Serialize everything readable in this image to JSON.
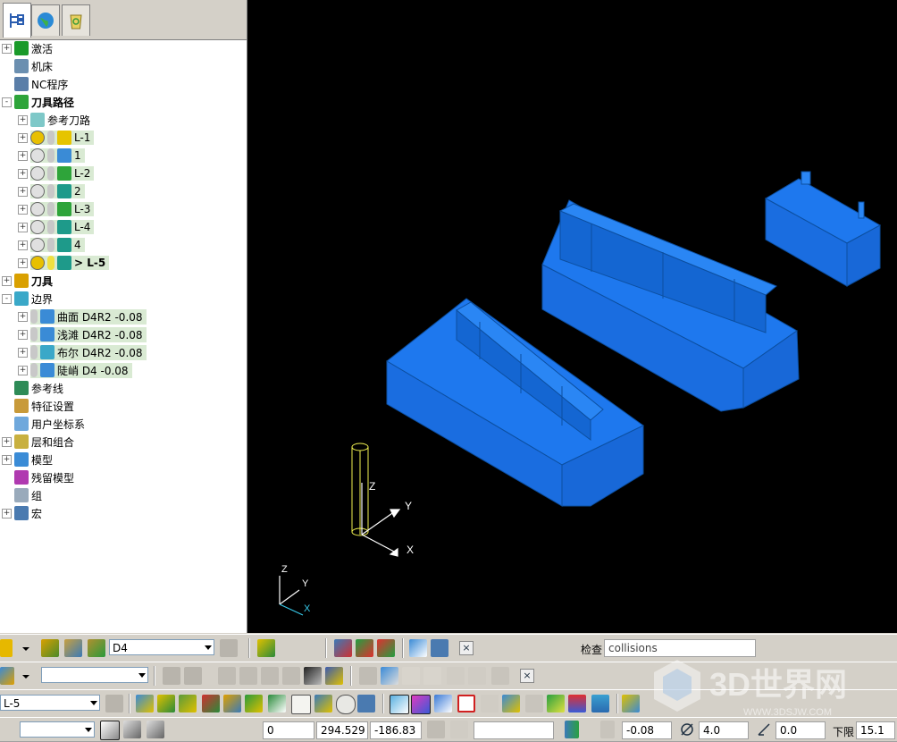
{
  "tree": {
    "items": [
      {
        "label": "激活",
        "icon": "activate-icon",
        "color": "#1a9a2a",
        "level": 0,
        "exp": "+"
      },
      {
        "label": "机床",
        "icon": "machine-icon",
        "color": "#6b8fb0",
        "level": 0,
        "exp": ""
      },
      {
        "label": "NC程序",
        "icon": "nc-program-icon",
        "color": "#5a7ea8",
        "level": 0,
        "exp": ""
      },
      {
        "label": "刀具路径",
        "icon": "toolpath-icon",
        "color": "#2ea43a",
        "level": 0,
        "exp": "-",
        "bold": true
      },
      {
        "label": "参考刀路",
        "icon": "folder-icon",
        "color": "#7ec8c8",
        "level": 1,
        "exp": "+"
      },
      {
        "label": "L-1",
        "icon": "toolpath-item-icon",
        "color": "#e6c400",
        "level": 1,
        "exp": "+",
        "hl": true
      },
      {
        "label": "1",
        "icon": "toolpath-item-icon",
        "color": "#3a8bd6",
        "level": 1,
        "exp": "+",
        "hl": true
      },
      {
        "label": "L-2",
        "icon": "toolpath-item-icon",
        "color": "#2ea43a",
        "level": 1,
        "exp": "+",
        "hl": true
      },
      {
        "label": "2",
        "icon": "toolpath-item-icon",
        "color": "#1e9a8a",
        "level": 1,
        "exp": "+",
        "hl": true
      },
      {
        "label": "L-3",
        "icon": "toolpath-item-icon",
        "color": "#2ea43a",
        "level": 1,
        "exp": "+",
        "hl": true
      },
      {
        "label": "L-4",
        "icon": "toolpath-item-icon",
        "color": "#1e9a8a",
        "level": 1,
        "exp": "+",
        "hl": true
      },
      {
        "label": "4",
        "icon": "toolpath-item-icon",
        "color": "#1e9a8a",
        "level": 1,
        "exp": "+",
        "hl": true
      },
      {
        "label": "> L-5",
        "icon": "toolpath-item-icon",
        "color": "#1e9a8a",
        "level": 1,
        "exp": "+",
        "hl": true,
        "bold": true
      },
      {
        "label": "刀具",
        "icon": "tool-icon",
        "color": "#d9a000",
        "level": 0,
        "exp": "+",
        "bold": true
      },
      {
        "label": "边界",
        "icon": "boundary-icon",
        "color": "#3aa8c8",
        "level": 0,
        "exp": "-"
      },
      {
        "label": "曲面 D4R2 -0.08",
        "icon": "boundary-item-icon",
        "color": "#3a8bd6",
        "level": 1,
        "exp": "+",
        "hl": true
      },
      {
        "label": "浅滩 D4R2 -0.08",
        "icon": "boundary-item-icon",
        "color": "#3a8bd6",
        "level": 1,
        "exp": "+",
        "hl": true
      },
      {
        "label": "布尔 D4R2 -0.08",
        "icon": "boundary-item-icon",
        "color": "#3aa8c8",
        "level": 1,
        "exp": "+",
        "hl": true
      },
      {
        "label": "陡峭 D4 -0.08",
        "icon": "boundary-item-icon",
        "color": "#3a8bd6",
        "level": 1,
        "exp": "+",
        "hl": true
      },
      {
        "label": "参考线",
        "icon": "pattern-icon",
        "color": "#2e8b57",
        "level": 0,
        "exp": ""
      },
      {
        "label": "特征设置",
        "icon": "feature-icon",
        "color": "#c89a3a",
        "level": 0,
        "exp": ""
      },
      {
        "label": "用户坐标系",
        "icon": "workplane-icon",
        "color": "#6fa8dc",
        "level": 0,
        "exp": ""
      },
      {
        "label": "层和组合",
        "icon": "layers-icon",
        "color": "#c8b040",
        "level": 0,
        "exp": "+"
      },
      {
        "label": "模型",
        "icon": "model-icon",
        "color": "#3a8bd6",
        "level": 0,
        "exp": "+"
      },
      {
        "label": "残留模型",
        "icon": "stock-model-icon",
        "color": "#b03ab0",
        "level": 0,
        "exp": ""
      },
      {
        "label": "组",
        "icon": "group-icon",
        "color": "#9ab",
        "level": 0,
        "exp": ""
      },
      {
        "label": "宏",
        "icon": "macro-icon",
        "color": "#4a7ab0",
        "level": 0,
        "exp": "+"
      }
    ]
  },
  "viewport": {
    "axis_labels": {
      "z": "Z",
      "y": "Y",
      "x": "X"
    },
    "triad_labels": {
      "z": "Z",
      "y": "Y",
      "x": "X"
    }
  },
  "toolbar1": {
    "tool_select": "D4",
    "check_label": "检查",
    "check_value": "collisions"
  },
  "toolbar2": {
    "select_value": ""
  },
  "toolbar3": {
    "select_value": "L-5"
  },
  "status": {
    "coord_a": "0",
    "coord_x": "294.529",
    "coord_y": "-186.83",
    "thickness": "-0.08",
    "diameter": "4.0",
    "tolerance": "0.0",
    "lower_label": "下限",
    "lower_value": "15.1"
  },
  "colors": {
    "part": "#1e78ee",
    "part_dark": "#1258c0",
    "tool": "#f0f050"
  }
}
